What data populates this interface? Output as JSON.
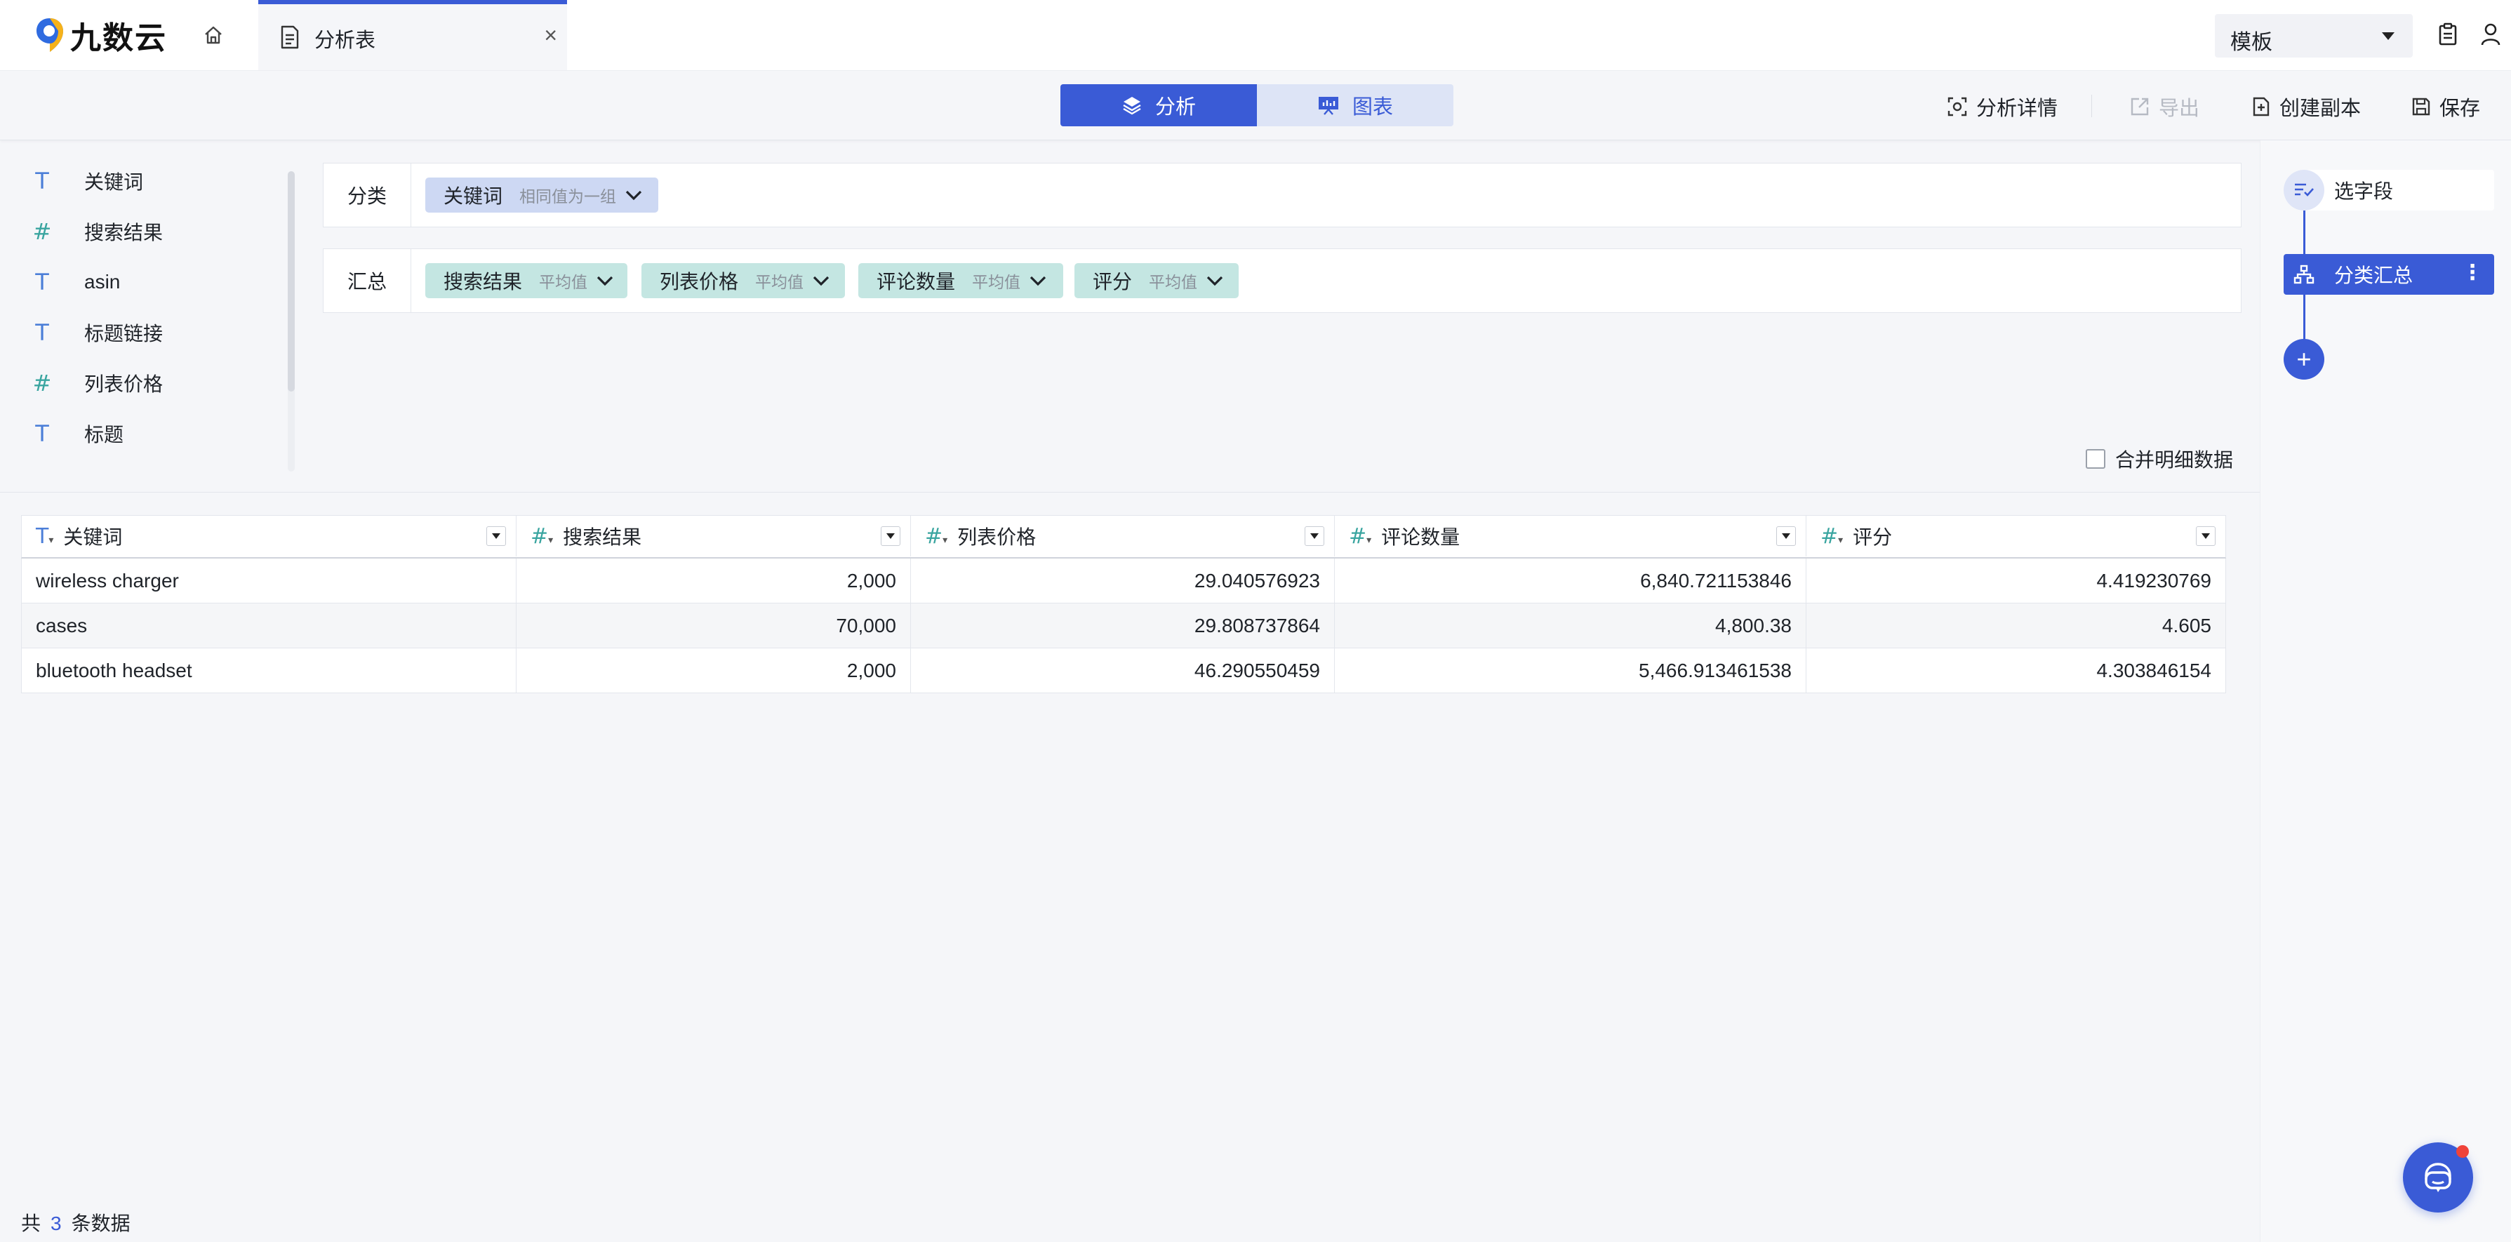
{
  "app": {
    "name": "九数云"
  },
  "tab": {
    "label": "分析表",
    "close": "×"
  },
  "template": {
    "label": "模板"
  },
  "modes": {
    "analysis": "分析",
    "chart": "图表"
  },
  "toolbar": {
    "details": "分析详情",
    "export": "导出",
    "copy": "创建副本",
    "save": "保存"
  },
  "fields": [
    {
      "type": "T",
      "name": "关键词"
    },
    {
      "type": "#",
      "name": "搜索结果"
    },
    {
      "type": "T",
      "name": "asin"
    },
    {
      "type": "T",
      "name": "标题链接"
    },
    {
      "type": "#",
      "name": "列表价格"
    },
    {
      "type": "T",
      "name": "标题"
    }
  ],
  "category": {
    "label": "分类",
    "chips": [
      {
        "name": "关键词",
        "sub": "相同值为一组"
      }
    ]
  },
  "summary": {
    "label": "汇总",
    "chips": [
      {
        "name": "搜索结果",
        "sub": "平均值"
      },
      {
        "name": "列表价格",
        "sub": "平均值"
      },
      {
        "name": "评论数量",
        "sub": "平均值"
      },
      {
        "name": "评分",
        "sub": "平均值"
      }
    ]
  },
  "merge_label": "合并明细数据",
  "table": {
    "columns": [
      {
        "type": "T",
        "label": "关键词"
      },
      {
        "type": "#",
        "label": "搜索结果"
      },
      {
        "type": "#",
        "label": "列表价格"
      },
      {
        "type": "#",
        "label": "评论数量"
      },
      {
        "type": "#",
        "label": "评分"
      }
    ],
    "rows": [
      [
        "wireless charger",
        "2,000",
        "29.040576923",
        "6,840.721153846",
        "4.419230769"
      ],
      [
        "cases",
        "70,000",
        "29.808737864",
        "4,800.38",
        "4.605"
      ],
      [
        "bluetooth headset",
        "2,000",
        "46.290550459",
        "5,466.913461538",
        "4.303846154"
      ]
    ]
  },
  "pipeline": {
    "select": "选字段",
    "group": "分类汇总",
    "add": "+"
  },
  "footer": {
    "prefix": "共",
    "count": "3",
    "suffix": "条数据"
  },
  "colors": {
    "accent": "#3a5bd6",
    "category_chip": "#cdd8f3",
    "summary_chip": "#c4e6e2",
    "text_field": "#4b7ed8",
    "number_field": "#3aa5a0"
  }
}
